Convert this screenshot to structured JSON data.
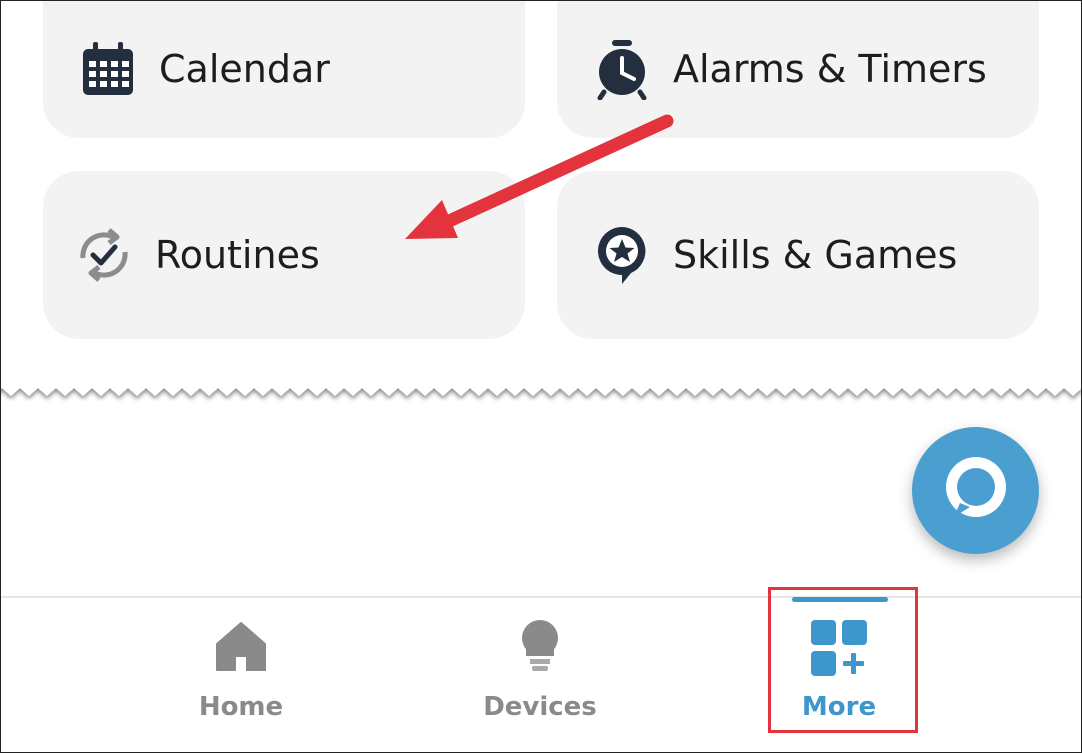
{
  "tiles": {
    "calendar": {
      "label": "Calendar",
      "icon": "calendar-icon"
    },
    "alarms": {
      "label": "Alarms & Timers",
      "icon": "alarm-clock-icon"
    },
    "routines": {
      "label": "Routines",
      "icon": "routines-icon"
    },
    "skills": {
      "label": "Skills & Games",
      "icon": "skills-star-icon"
    }
  },
  "fab": {
    "icon": "alexa-icon"
  },
  "nav": {
    "home": {
      "label": "Home",
      "icon": "home-icon"
    },
    "devices": {
      "label": "Devices",
      "icon": "lightbulb-icon"
    },
    "more": {
      "label": "More",
      "icon": "more-grid-icon",
      "active": true
    }
  },
  "colors": {
    "accent": "#3d96cc",
    "annotation": "#e3333d",
    "tile_bg": "#f3f3f3"
  }
}
